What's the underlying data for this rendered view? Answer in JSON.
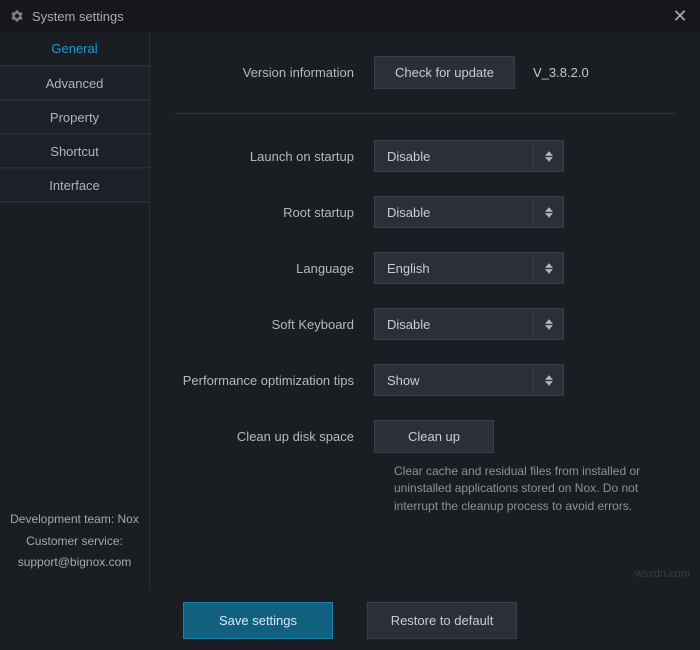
{
  "window": {
    "title": "System settings"
  },
  "sidebar": {
    "tabs": [
      {
        "label": "General",
        "active": true
      },
      {
        "label": "Advanced",
        "active": false
      },
      {
        "label": "Property",
        "active": false
      },
      {
        "label": "Shortcut",
        "active": false
      },
      {
        "label": "Interface",
        "active": false
      }
    ],
    "footer": {
      "team": "Development team: Nox",
      "service_label": "Customer service:",
      "email": "support@bignox.com"
    }
  },
  "content": {
    "version": {
      "label": "Version information",
      "button": "Check for update",
      "value": "V_3.8.2.0"
    },
    "launch_startup": {
      "label": "Launch on startup",
      "value": "Disable"
    },
    "root_startup": {
      "label": "Root startup",
      "value": "Disable"
    },
    "language": {
      "label": "Language",
      "value": "English"
    },
    "soft_keyboard": {
      "label": "Soft Keyboard",
      "value": "Disable"
    },
    "perf_tips": {
      "label": "Performance optimization tips",
      "value": "Show"
    },
    "cleanup": {
      "label": "Clean up disk space",
      "button": "Clean up",
      "help": "Clear cache and residual files from installed or uninstalled applications stored on Nox. Do not interrupt the cleanup process to avoid errors."
    }
  },
  "footer": {
    "save": "Save settings",
    "restore": "Restore to default"
  },
  "watermark": "wsxdn.com"
}
